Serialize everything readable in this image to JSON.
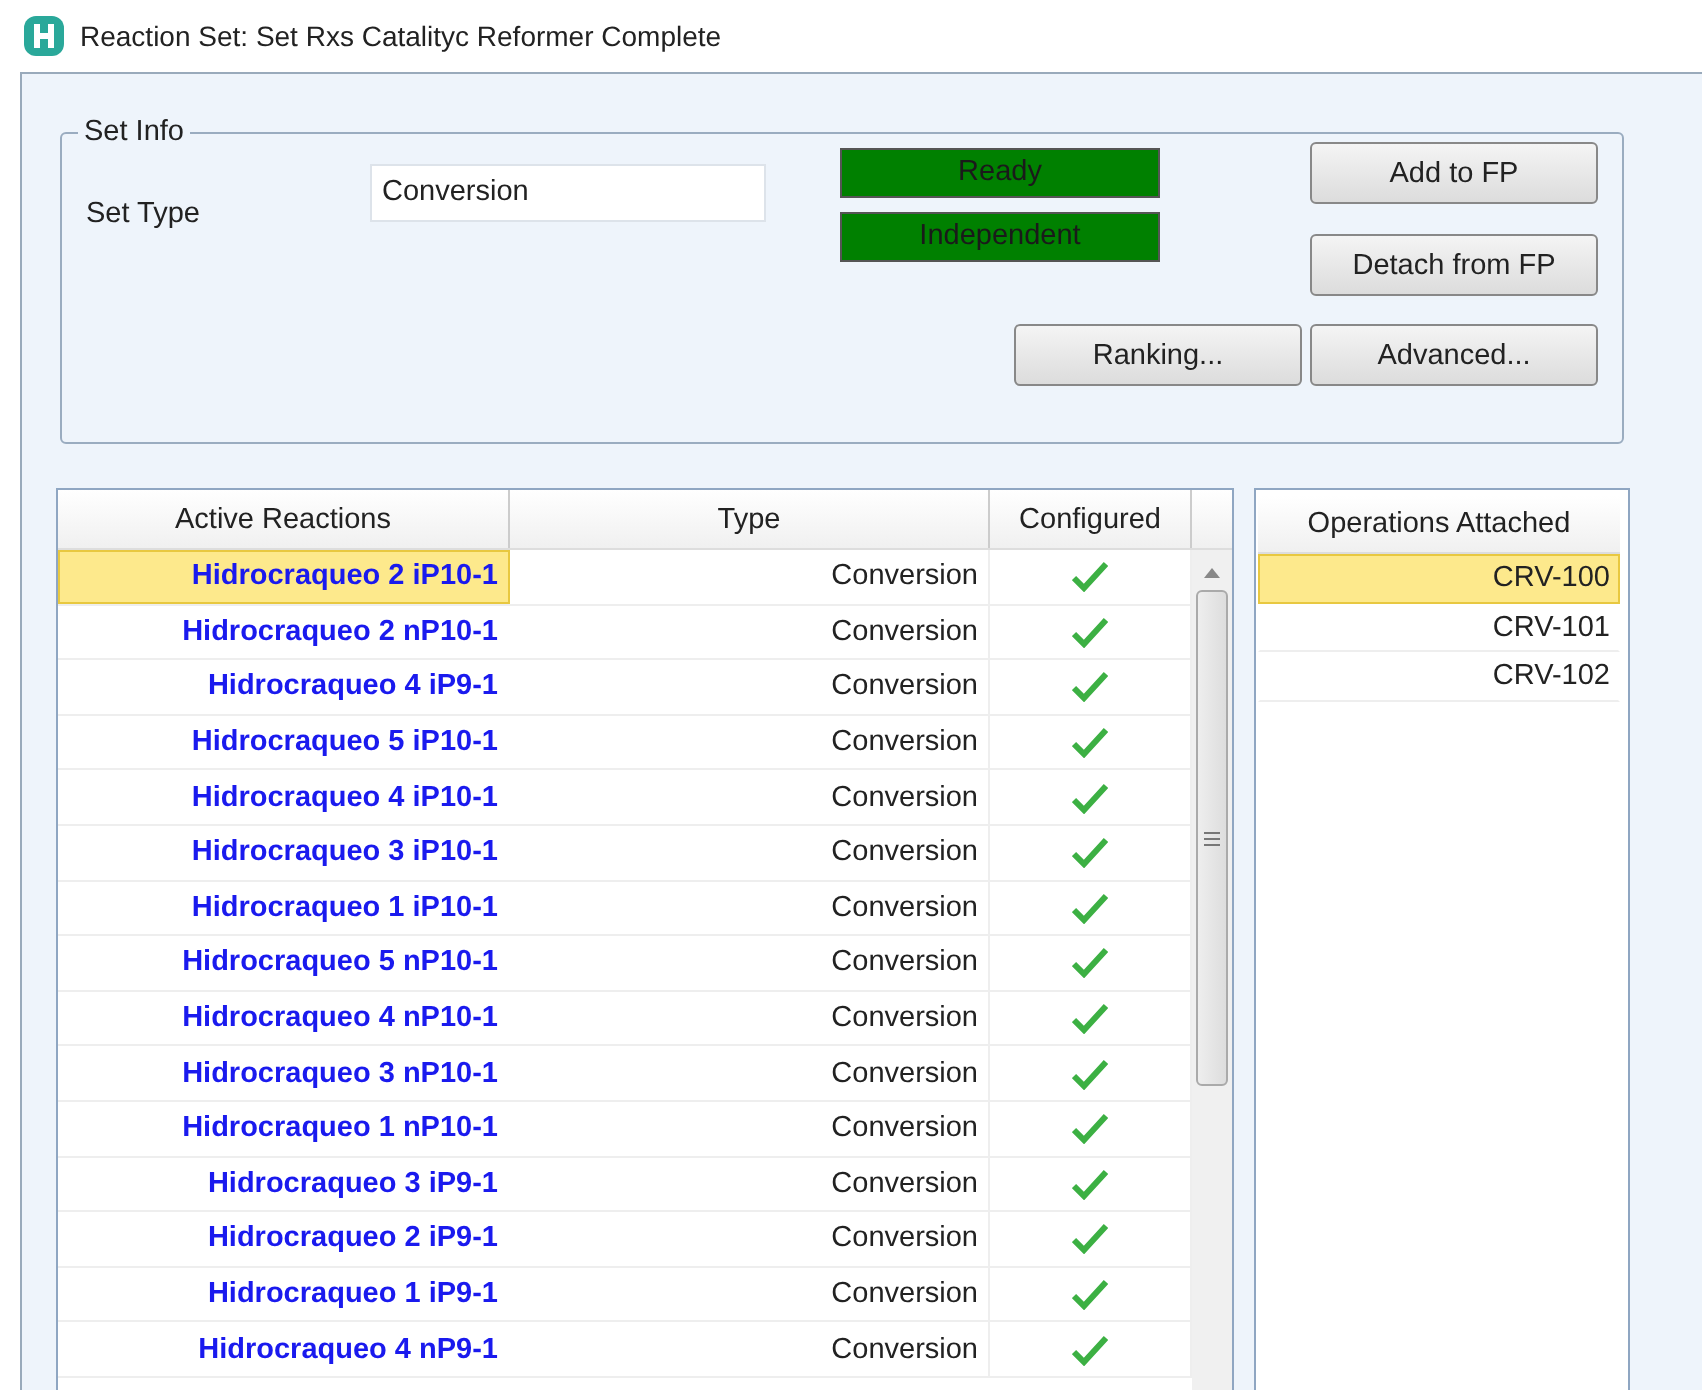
{
  "window": {
    "title": "Reaction Set: Set Rxs Catalityc Reformer Complete"
  },
  "set_info": {
    "legend": "Set Info",
    "set_type_label": "Set Type",
    "set_type": "Conversion",
    "status": [
      {
        "label": "Ready",
        "color": "#008000"
      },
      {
        "label": "Independent",
        "color": "#008000"
      }
    ],
    "buttons": [
      "Add to FP",
      "Detach from FP",
      "Ranking...",
      "Advanced..."
    ]
  },
  "reactions": {
    "columns": [
      "Active Reactions",
      "Type",
      "Configured"
    ],
    "rows": [
      {
        "name": "Hidrocraqueo 2 iP10-1",
        "type": "Conversion",
        "configured": true,
        "selected": true
      },
      {
        "name": "Hidrocraqueo 2 nP10-1",
        "type": "Conversion",
        "configured": true,
        "selected": false
      },
      {
        "name": "Hidrocraqueo 4 iP9-1",
        "type": "Conversion",
        "configured": true,
        "selected": false
      },
      {
        "name": "Hidrocraqueo 5 iP10-1",
        "type": "Conversion",
        "configured": true,
        "selected": false
      },
      {
        "name": "Hidrocraqueo 4 iP10-1",
        "type": "Conversion",
        "configured": true,
        "selected": false
      },
      {
        "name": "Hidrocraqueo 3 iP10-1",
        "type": "Conversion",
        "configured": true,
        "selected": false
      },
      {
        "name": "Hidrocraqueo 1 iP10-1",
        "type": "Conversion",
        "configured": true,
        "selected": false
      },
      {
        "name": "Hidrocraqueo 5 nP10-1",
        "type": "Conversion",
        "configured": true,
        "selected": false
      },
      {
        "name": "Hidrocraqueo 4 nP10-1",
        "type": "Conversion",
        "configured": true,
        "selected": false
      },
      {
        "name": "Hidrocraqueo 3 nP10-1",
        "type": "Conversion",
        "configured": true,
        "selected": false
      },
      {
        "name": "Hidrocraqueo 1 nP10-1",
        "type": "Conversion",
        "configured": true,
        "selected": false
      },
      {
        "name": "Hidrocraqueo 3 iP9-1",
        "type": "Conversion",
        "configured": true,
        "selected": false
      },
      {
        "name": "Hidrocraqueo 2 iP9-1",
        "type": "Conversion",
        "configured": true,
        "selected": false
      },
      {
        "name": "Hidrocraqueo 1 iP9-1",
        "type": "Conversion",
        "configured": true,
        "selected": false
      },
      {
        "name": "Hidrocraqueo 4 nP9-1",
        "type": "Conversion",
        "configured": true,
        "selected": false
      }
    ]
  },
  "operations": {
    "header": "Operations Attached",
    "items": [
      {
        "label": "CRV-100",
        "selected": true
      },
      {
        "label": "CRV-101",
        "selected": false
      },
      {
        "label": "CRV-102",
        "selected": false
      }
    ]
  }
}
